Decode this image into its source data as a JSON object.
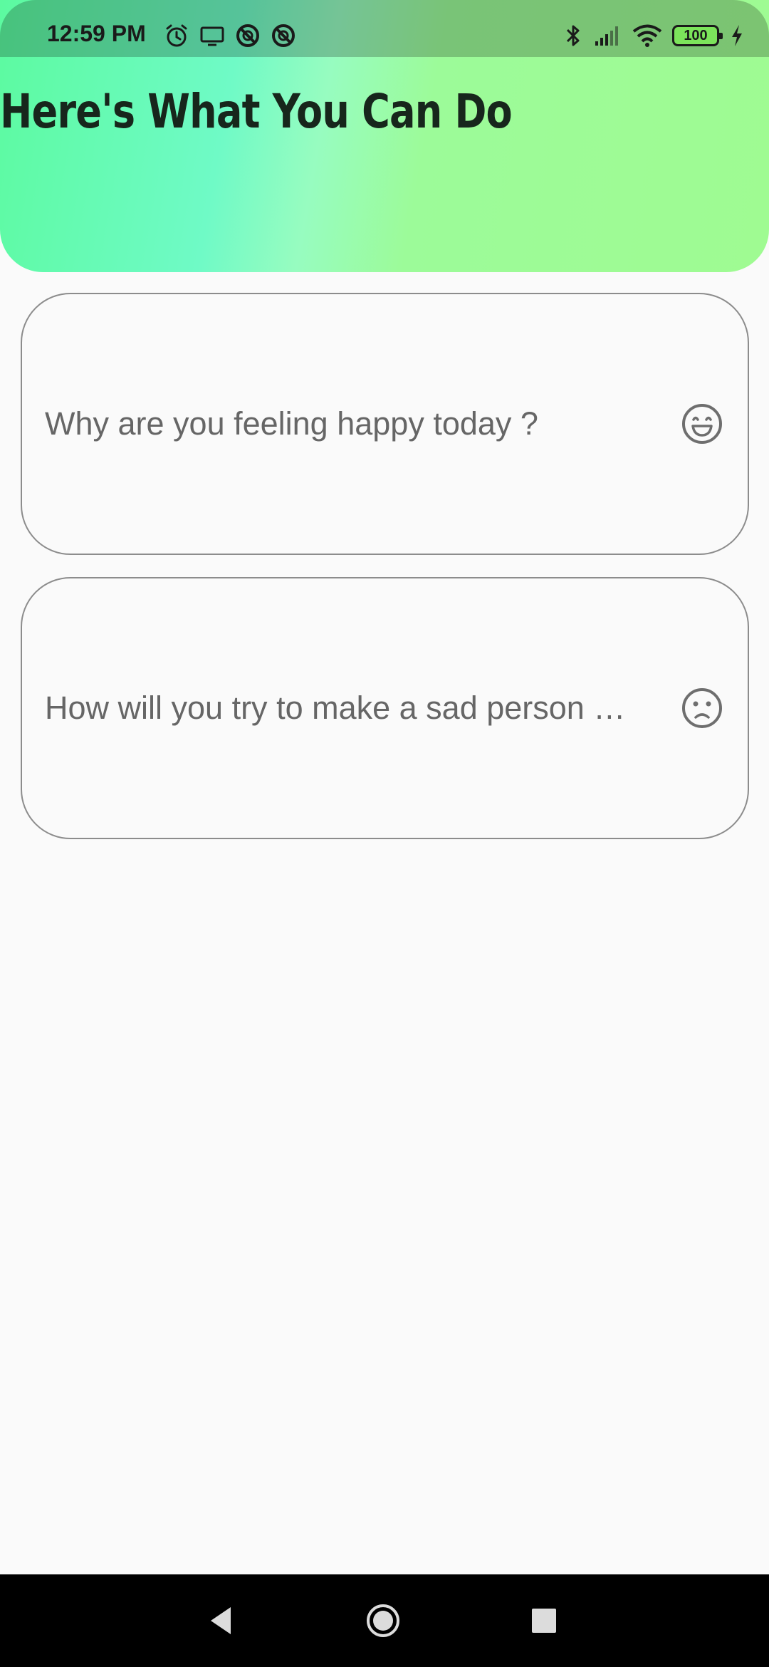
{
  "status_bar": {
    "time": "12:59 PM",
    "battery_level": "100",
    "left_icons": [
      "alarm-icon",
      "screen-cast-icon",
      "dnd-icon",
      "dnd-icon"
    ],
    "right_icons": [
      "bluetooth-icon",
      "signal-icon",
      "wifi-icon",
      "battery-icon",
      "charging-icon"
    ]
  },
  "header": {
    "title": "Here's What You Can Do",
    "gradient_colors": [
      "#5cfaa0",
      "#6ffac6",
      "#97fcc0",
      "#9ffb92"
    ]
  },
  "cards": [
    {
      "text": "Why are you feeling happy today ?",
      "icon": "happy-face-icon"
    },
    {
      "text": "How will you try to make a sad person …",
      "icon": "sad-face-icon"
    }
  ],
  "nav_bar": {
    "buttons": [
      "back-icon",
      "home-icon",
      "recents-icon"
    ]
  }
}
